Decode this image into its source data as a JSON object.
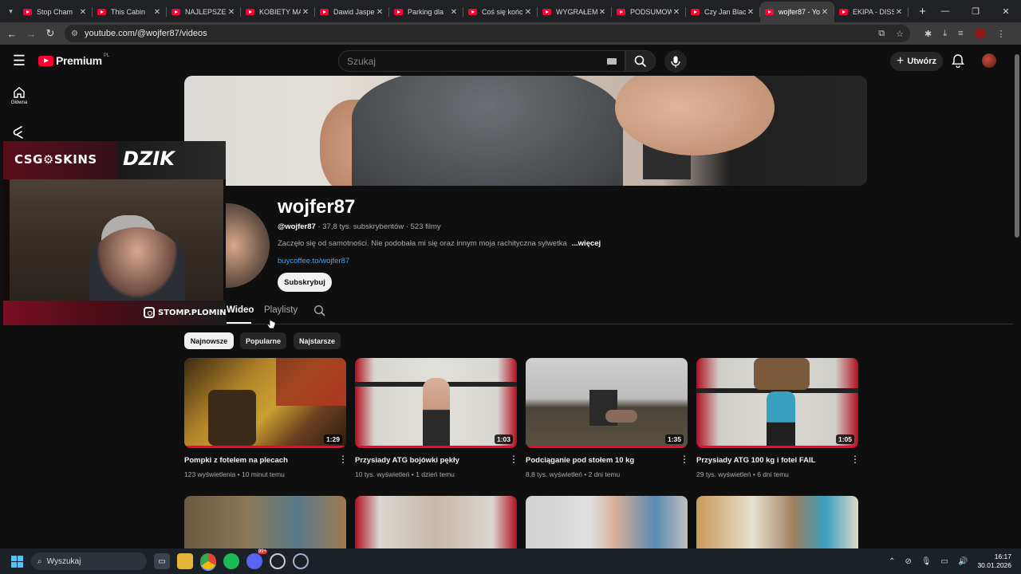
{
  "browser": {
    "tabs": [
      {
        "title": "Stop Cham"
      },
      {
        "title": "This Cabin"
      },
      {
        "title": "NAJLEPSZE"
      },
      {
        "title": "KOBIETY MA"
      },
      {
        "title": "Dawid Jaspe"
      },
      {
        "title": "Parking dla"
      },
      {
        "title": "Coś się końc"
      },
      {
        "title": "WYGRAŁEM"
      },
      {
        "title": "PODSUMOW"
      },
      {
        "title": "Czy Jan Blac"
      },
      {
        "title": "wojfer87 - Yo",
        "active": true
      },
      {
        "title": "EKIPA - DISS"
      }
    ],
    "url": "youtube.com/@wojfer87/videos"
  },
  "masthead": {
    "logo_text": "Premium",
    "region": "PL",
    "search_placeholder": "Szukaj",
    "create_label": "Utwórz"
  },
  "sidebar": {
    "items": [
      {
        "label": "Główna",
        "icon": "home-icon"
      },
      {
        "label": "",
        "icon": "shorts-icon"
      }
    ]
  },
  "overlay": {
    "sponsor1": "CSG⚙SKINS",
    "sponsor2": "DZIK",
    "instagram": "STOMP.PLOMINSKI"
  },
  "channel": {
    "name": "wojfer87",
    "handle": "@wojfer87",
    "subscribers": "37,8 tys. subskrybentów",
    "video_count": "523 filmy",
    "description": "Zaczęło się od samotności. Nie podobała mi się oraz innym moja rachityczna sylwetka",
    "more_label": "...więcej",
    "link": "buycoffee.to/wojfer87",
    "subscribe_label": "Subskrybuj",
    "tabs": [
      "Wideo",
      "Playlisty"
    ]
  },
  "filters": {
    "chips": [
      "Najnowsze",
      "Popularne",
      "Najstarsze"
    ],
    "selected": "Najnowsze"
  },
  "videos": [
    {
      "title": "Pompki z fotelem na plecach",
      "views": "123 wyświetlenia",
      "age": "10 minut temu",
      "duration": "1:29"
    },
    {
      "title": "Przysiady ATG bojówki pękły",
      "views": "10 tys. wyświetleń",
      "age": "1 dzień temu",
      "duration": "1:03"
    },
    {
      "title": "Podciąganie pod stołem 10 kg",
      "views": "8,8 tys. wyświetleń",
      "age": "2 dni temu",
      "duration": "1:35"
    },
    {
      "title": "Przysiady ATG 100 kg i fotel FAIL",
      "views": "29 tys. wyświetleń",
      "age": "6 dni temu",
      "duration": "1:05"
    }
  ],
  "taskbar": {
    "search_placeholder": "Wyszukaj",
    "time": "16:17",
    "date": "30.01.2026",
    "badge": "99+"
  },
  "colors": {
    "accent": "#ff0033",
    "link": "#3ea6ff",
    "background": "#0f0f0f"
  }
}
